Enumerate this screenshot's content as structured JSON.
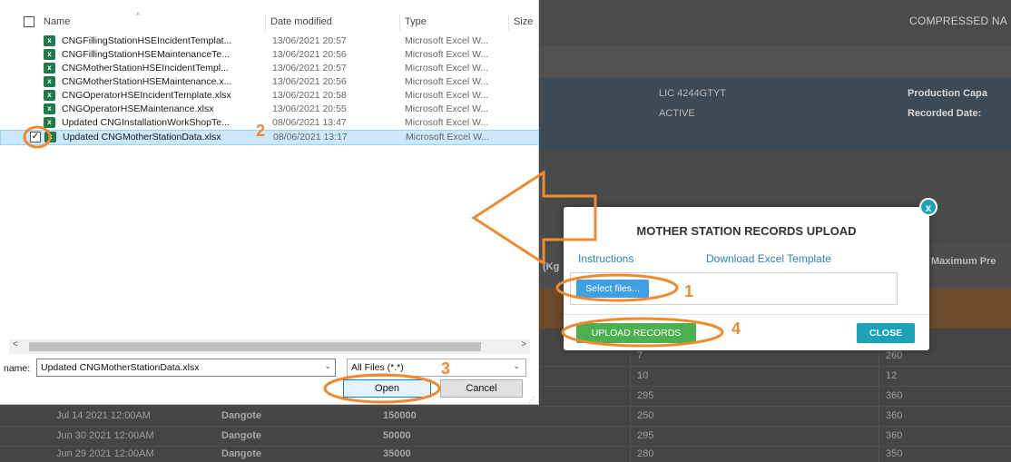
{
  "background_page": {
    "title": "COMPRESSED NA",
    "license": "LIC 4244GTYT",
    "status": "ACTIVE",
    "production_capacity_label": "Production Capa",
    "recorded_date_label": "Recorded Date:",
    "col_kg": "(Kg",
    "col_max_pressure": "Maximum Pre",
    "rows": [
      {
        "date": "",
        "name": "",
        "qty": "",
        "v1": "7",
        "v2": "260"
      },
      {
        "date": "",
        "name": "",
        "qty": "",
        "v1": "10",
        "v2": "12"
      },
      {
        "date": "",
        "name": "",
        "qty": "",
        "v1": "295",
        "v2": "360"
      },
      {
        "date": "Jul 14 2021 12:00AM",
        "name": "Dangote",
        "qty": "150000",
        "v1": "250",
        "v2": "360"
      },
      {
        "date": "Jun 30 2021 12:00AM",
        "name": "Dangote",
        "qty": "50000",
        "v1": "295",
        "v2": "360"
      },
      {
        "date": "Jun 29 2021 12:00AM",
        "name": "Dangote",
        "qty": "35000",
        "v1": "280",
        "v2": "350"
      }
    ]
  },
  "file_dialog": {
    "columns": {
      "name": "Name",
      "date": "Date modified",
      "type": "Type",
      "size": "Size"
    },
    "files": [
      {
        "name": "CNGFillingStationHSEIncidentTemplat...",
        "date": "13/06/2021 20:57",
        "type": "Microsoft Excel W...",
        "selected": false
      },
      {
        "name": "CNGFillingStationHSEMaintenanceTe...",
        "date": "13/06/2021 20:56",
        "type": "Microsoft Excel W...",
        "selected": false
      },
      {
        "name": "CNGMotherStationHSEIncidentTempl...",
        "date": "13/06/2021 20:57",
        "type": "Microsoft Excel W...",
        "selected": false
      },
      {
        "name": "CNGMotherStationHSEMaintenance.x...",
        "date": "13/06/2021 20:56",
        "type": "Microsoft Excel W...",
        "selected": false
      },
      {
        "name": "CNGOperatorHSEIncidentTemplate.xlsx",
        "date": "13/06/2021 20:58",
        "type": "Microsoft Excel W...",
        "selected": false
      },
      {
        "name": "CNGOperatorHSEMaintenance.xlsx",
        "date": "13/06/2021 20:55",
        "type": "Microsoft Excel W...",
        "selected": false
      },
      {
        "name": "Updated CNGInstallationWorkShopTe...",
        "date": "08/06/2021 13:47",
        "type": "Microsoft Excel W...",
        "selected": false
      },
      {
        "name": "Updated CNGMotherStationData.xlsx",
        "date": "08/06/2021 13:17",
        "type": "Microsoft Excel W...",
        "selected": true
      }
    ],
    "file_name_label": "name:",
    "file_name_value": "Updated CNGMotherStationData.xlsx",
    "file_type_value": "All Files (*.*)",
    "open_label": "Open",
    "cancel_label": "Cancel"
  },
  "modal": {
    "title": "MOTHER STATION RECORDS UPLOAD",
    "instructions_link": "Instructions",
    "download_link": "Download Excel Template",
    "select_files_label": "Select files...",
    "upload_label": "UPLOAD RECORDS",
    "close_label": "CLOSE",
    "close_x": "x"
  },
  "annotations": {
    "step1": "1",
    "step2": "2",
    "step3": "3",
    "step4": "4",
    "color": "#f08a2e"
  }
}
